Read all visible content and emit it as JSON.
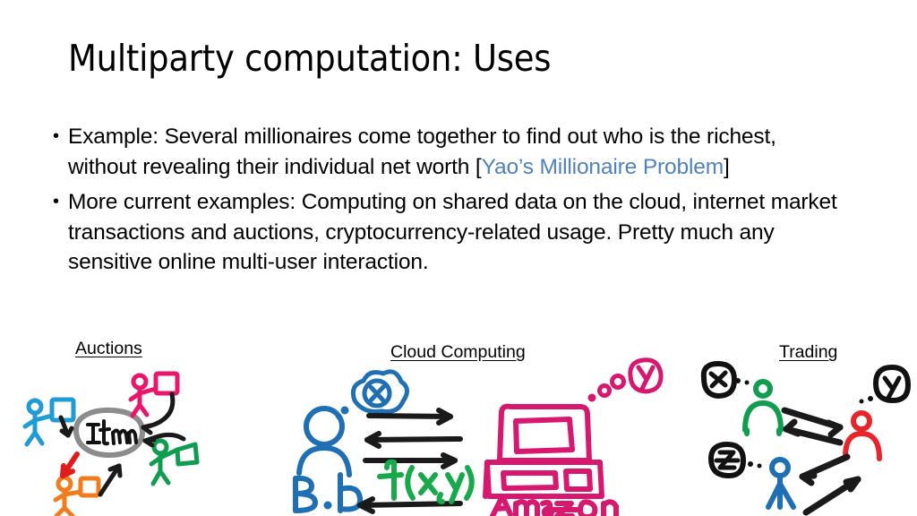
{
  "slide": {
    "title": "Multiparty computation: Uses",
    "background_color": "#ffffff",
    "link_color": "#4f81bd"
  },
  "body": {
    "bullets": [
      {
        "marker": "•",
        "segments": [
          {
            "text": "Example: Several millionaires come together to find out who is the richest, without revealing their individual net worth [",
            "style": "plain"
          },
          {
            "text": "Yao’s Millionaire Problem",
            "style": "link"
          },
          {
            "text": "]",
            "style": "plain"
          }
        ],
        "plain_text": "Example: Several millionaires come together to find out who is the richest, without revealing their individual net worth [Yao’s Millionaire Problem]"
      },
      {
        "marker": "•",
        "segments": [
          {
            "text": "More current examples: Computing on shared data on the cloud, internet market transactions and auctions, cryptocurrency-related usage. Pretty much any sensitive online multi-user interaction.",
            "style": "plain"
          }
        ],
        "plain_text": "More current examples: Computing on shared data on the cloud, internet market transactions and auctions, cryptocurrency-related usage. Pretty much any sensitive online multi-user interaction."
      }
    ],
    "bullet_1_prefix": "Example: Several millionaires come together to find out who is the richest, without revealing their individual net worth [",
    "bullet_1_link": "Yao’s Millionaire Problem",
    "bullet_1_suffix": "]",
    "bullet_2": "More current examples: Computing on shared data on the cloud, internet market transactions and auctions, cryptocurrency-related usage. Pretty much any sensitive online multi-user interaction."
  },
  "figures": [
    {
      "caption": "Auctions",
      "description": "Hand-drawn auction diagram: four bidders with paddles point arrows at a gray oval labeled Item.",
      "center_label": "Item",
      "center_shape_color": "#8c8c8c",
      "actors": [
        {
          "name": "bidder-blue",
          "color": "#1f9bd6"
        },
        {
          "name": "bidder-pink",
          "color": "#e8176b"
        },
        {
          "name": "bidder-green",
          "color": "#0f9d4f"
        },
        {
          "name": "bidder-orange",
          "color": "#f07c1e"
        }
      ],
      "arrow_colors": {
        "normal": "#1a1a1a",
        "winner": "#e01b1b"
      }
    },
    {
      "caption": "Cloud Computing",
      "description": "Bob with thought bubble x exchanges messages with the Amazon computer which holds y; the joint function f(x,y) is computed.",
      "actor_label": "Bob",
      "actor_color": "#1f6fb5",
      "actor_secret": "x",
      "server_label": "Amazon",
      "server_color": "#d6186e",
      "server_secret": "y",
      "function_label": "f(x,y)",
      "function_color": "#17a94a",
      "arrow_color": "#1a1a1a",
      "arrow_count": 4
    },
    {
      "caption": "Trading",
      "description": "Three traders holding secrets x, y and z exchange arrows with each other.",
      "actors": [
        {
          "name": "trader-green",
          "color": "#0f9d4f",
          "secret": "x"
        },
        {
          "name": "trader-red",
          "color": "#e8252a",
          "secret": "y"
        },
        {
          "name": "trader-blue",
          "color": "#1f6fb5",
          "secret": "z"
        }
      ],
      "bubble_color": "#111111",
      "arrow_color": "#1a1a1a"
    }
  ],
  "captions": {
    "auctions": "Auctions",
    "cloud": "Cloud Computing",
    "trading": "Trading"
  },
  "sketch_labels": {
    "item": "Item",
    "bob": "Bob",
    "bob_secret": "x",
    "amazon": "Amazon",
    "amazon_secret": "y",
    "function": "f(x,y)",
    "trading_x": "x",
    "trading_y": "y",
    "trading_z": "z"
  }
}
